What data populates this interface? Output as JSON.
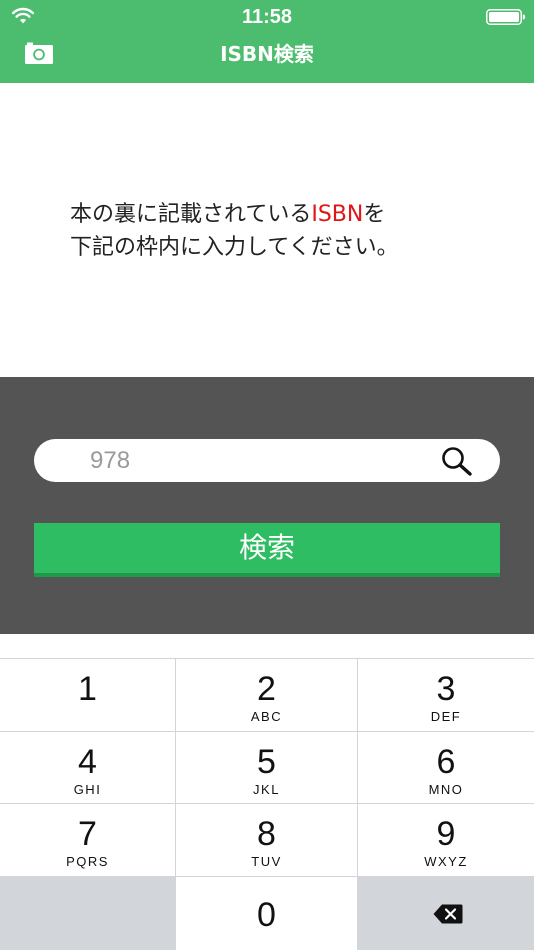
{
  "status_bar": {
    "time": "11:58",
    "wifi_icon": "wifi-icon",
    "battery_icon": "battery-icon"
  },
  "header": {
    "title": "ISBN検索",
    "camera_icon": "camera-icon",
    "background_color": "#4cbd6e"
  },
  "instructions": {
    "line1_before": "本の裏に記載されている",
    "line1_highlight": "ISBN",
    "line1_after": "を",
    "line2": "下記の枠内に入力してください。",
    "highlight_color": "#e01515"
  },
  "search": {
    "input_value": "978",
    "search_icon": "search-icon",
    "button_label": "検索",
    "panel_color": "#545454",
    "button_color": "#2ebd62"
  },
  "keypad": {
    "keys": [
      {
        "digit": "1",
        "letters": ""
      },
      {
        "digit": "2",
        "letters": "ABC"
      },
      {
        "digit": "3",
        "letters": "DEF"
      },
      {
        "digit": "4",
        "letters": "GHI"
      },
      {
        "digit": "5",
        "letters": "JKL"
      },
      {
        "digit": "6",
        "letters": "MNO"
      },
      {
        "digit": "7",
        "letters": "PQRS"
      },
      {
        "digit": "8",
        "letters": "TUV"
      },
      {
        "digit": "9",
        "letters": "WXYZ"
      },
      {
        "digit": "0",
        "letters": ""
      }
    ],
    "backspace_icon": "backspace-icon"
  }
}
